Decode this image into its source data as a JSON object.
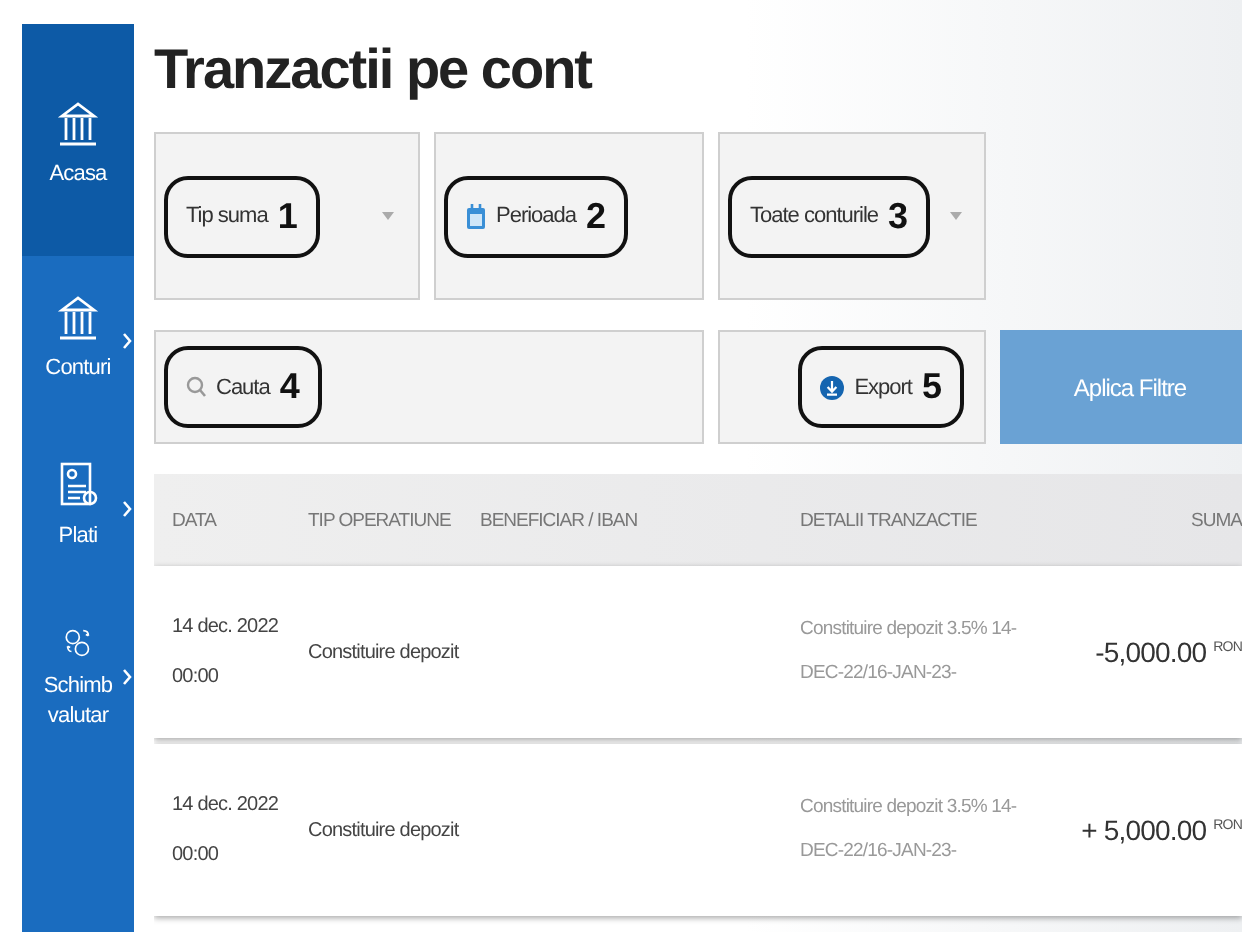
{
  "sidebar": {
    "items": [
      {
        "label": "Acasa",
        "kind": "bank",
        "selected": true,
        "has_submenu": false
      },
      {
        "label": "Conturi",
        "kind": "bank",
        "selected": false,
        "has_submenu": true
      },
      {
        "label": "Plati",
        "kind": "document",
        "selected": false,
        "has_submenu": true
      },
      {
        "label": "Schimb valutar",
        "kind": "exchange",
        "selected": false,
        "has_submenu": true
      }
    ]
  },
  "title": "Tranzactii pe cont",
  "filters": [
    {
      "kind": "dropdown",
      "label": "Tip suma",
      "marker": "1"
    },
    {
      "kind": "date",
      "label": "Perioada",
      "marker": "2"
    },
    {
      "kind": "dropdown",
      "label": "Toate conturile",
      "marker": "3"
    }
  ],
  "search": {
    "placeholder": "Cauta",
    "marker": "4"
  },
  "export": {
    "label": "Export",
    "marker": "5"
  },
  "apply_button": "Aplica Filtre",
  "table": {
    "columns": [
      "DATA",
      "TIP OPERATIUNE",
      "BENEFICIAR / IBAN",
      "DETALII TRANZACTIE",
      "SUMA"
    ],
    "rows": [
      {
        "date": "14 dec. 2022",
        "time": "00:00",
        "type": "Constituire depozit",
        "details": "Constituire depozit 3.5% 14-DEC-22/16-JAN-23-",
        "amount": "-5,000.00",
        "currency": "RON"
      },
      {
        "date": "14 dec. 2022",
        "time": "00:00",
        "type": "Constituire depozit",
        "details": "Constituire depozit 3.5% 14-DEC-22/16-JAN-23-",
        "amount": "+ 5,000.00",
        "currency": "RON"
      }
    ]
  }
}
